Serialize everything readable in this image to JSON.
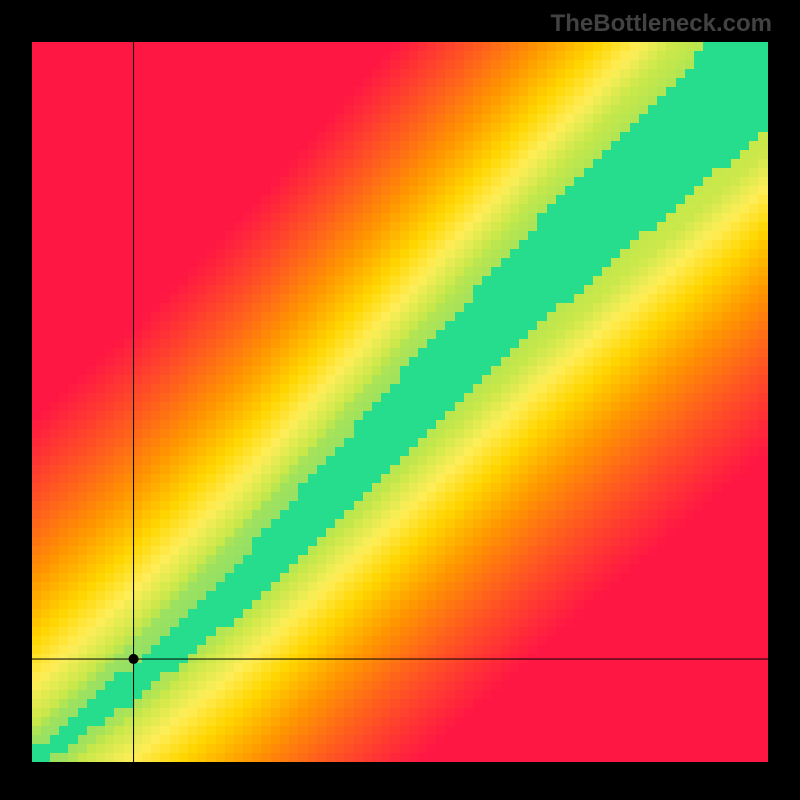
{
  "watermark": "TheBottleneck.com",
  "chart_data": {
    "type": "heatmap",
    "title": "",
    "xlabel": "",
    "ylabel": "",
    "xlim": [
      0,
      1
    ],
    "ylim": [
      0,
      1
    ],
    "grid": false,
    "resolution": 80,
    "crosshair": {
      "x": 0.138,
      "y": 0.143
    },
    "marker": {
      "x": 0.138,
      "y": 0.143
    },
    "color_stops": [
      {
        "t": 0.0,
        "color": "#ff1744"
      },
      {
        "t": 0.2,
        "color": "#ff5722"
      },
      {
        "t": 0.4,
        "color": "#ff9800"
      },
      {
        "t": 0.58,
        "color": "#ffd600"
      },
      {
        "t": 0.72,
        "color": "#ffee58"
      },
      {
        "t": 0.86,
        "color": "#c6e84a"
      },
      {
        "t": 0.96,
        "color": "#4dd68a"
      },
      {
        "t": 1.0,
        "color": "#00e593"
      }
    ],
    "band": {
      "start_width": 0.028,
      "end_width": 0.2,
      "control_points": [
        {
          "x": 0.0,
          "y": 0.0
        },
        {
          "x": 0.15,
          "y": 0.12
        },
        {
          "x": 0.3,
          "y": 0.26
        },
        {
          "x": 0.5,
          "y": 0.48
        },
        {
          "x": 0.7,
          "y": 0.69
        },
        {
          "x": 1.0,
          "y": 0.98
        }
      ]
    },
    "gradient_bias": {
      "origin": [
        0.0,
        0.0
      ],
      "far": [
        1.0,
        1.0
      ]
    }
  }
}
